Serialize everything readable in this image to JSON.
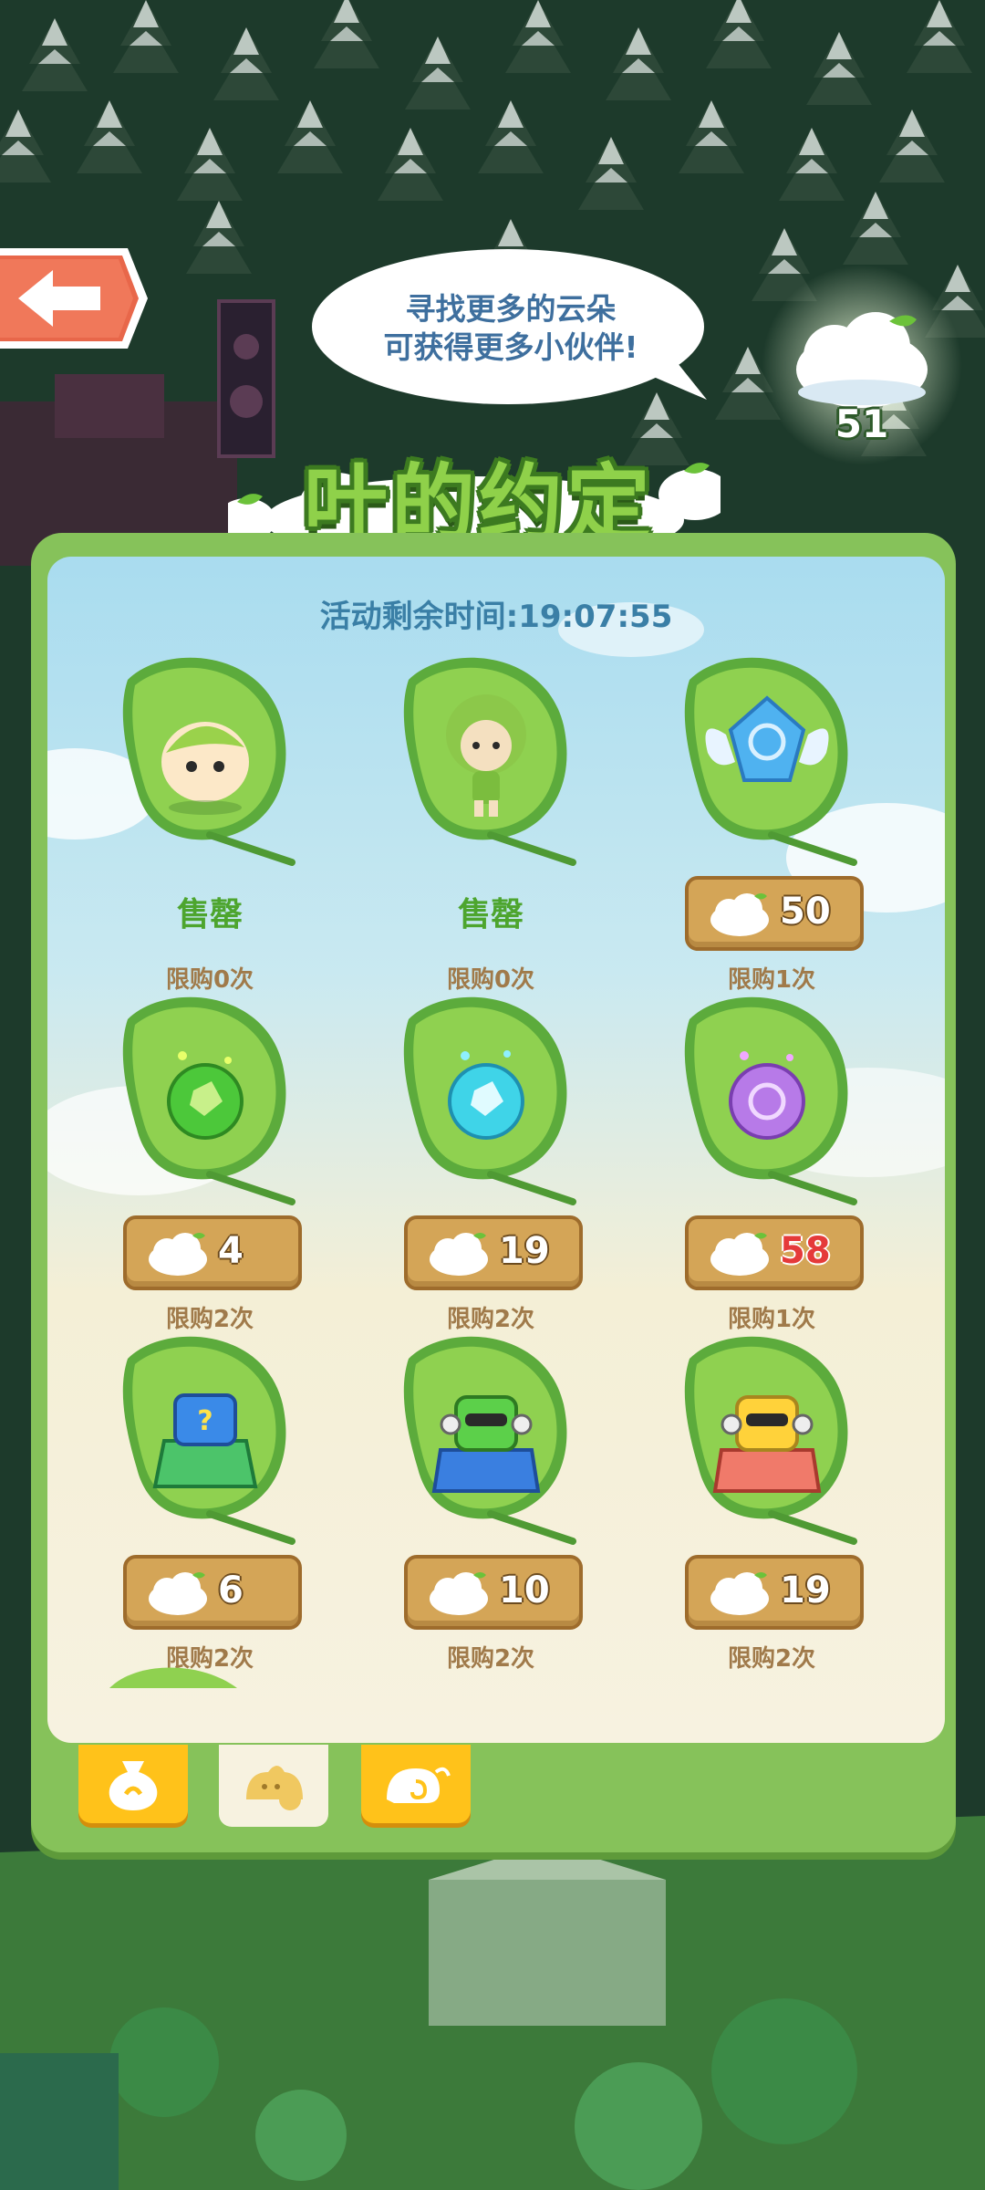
{
  "header": {
    "back_label": "",
    "speech_bubble": [
      "寻找更多的云朵",
      "可获得更多小伙伴!"
    ],
    "cloud_count": "51",
    "title": "叶的约定"
  },
  "panel": {
    "timer": "活动剩余时间:19:07:55",
    "items": [
      {
        "name": "leaf-sprout-pet",
        "sold_label": "售罄",
        "limit": "限购0次"
      },
      {
        "name": "leaf-fairy-character",
        "sold_label": "售罄",
        "limit": "限购0次"
      },
      {
        "name": "winged-crystal",
        "price": "50",
        "limit": "限购1次"
      },
      {
        "name": "green-orb",
        "price": "4",
        "limit": "限购2次"
      },
      {
        "name": "blue-orb",
        "price": "19",
        "limit": "限购2次"
      },
      {
        "name": "purple-orb",
        "price": "58",
        "price_color": "#e53a3a",
        "limit": "限购1次"
      },
      {
        "name": "mystery-pet-bag",
        "price": "6",
        "limit": "限购2次"
      },
      {
        "name": "green-robot-pet-bag",
        "price": "10",
        "limit": "限购2次"
      },
      {
        "name": "yellow-robot-pet-bag",
        "price": "19",
        "limit": "限购2次"
      }
    ]
  },
  "tabs": [
    {
      "name": "tab-bag",
      "icon": "bag-icon",
      "active": false
    },
    {
      "name": "tab-pets",
      "icon": "pets-icon",
      "active": true
    },
    {
      "name": "tab-snail",
      "icon": "snail-icon",
      "active": false
    }
  ],
  "colors": {
    "panel": "#86c25a",
    "price_bg": "#d4a557",
    "sold": "#4da52e",
    "limit": "#a07a4a",
    "timer": "#3a7fa6"
  }
}
